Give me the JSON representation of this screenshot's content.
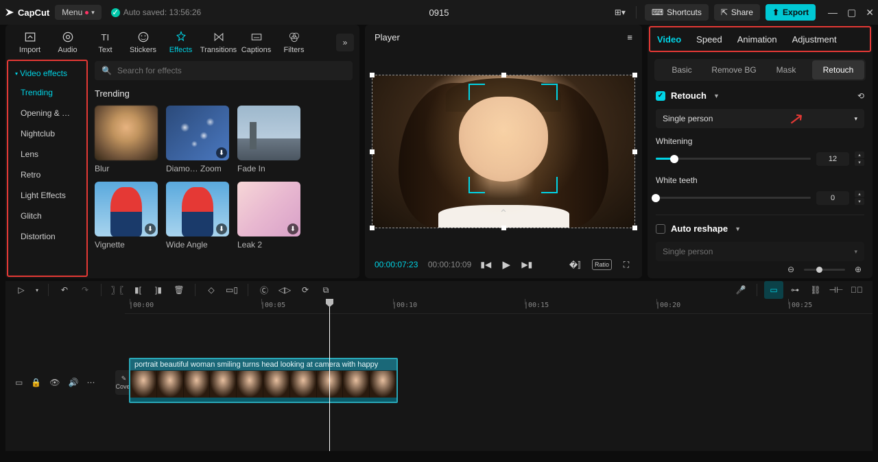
{
  "titlebar": {
    "app": "CapCut",
    "menu": "Menu",
    "autosave": "Auto saved: 13:56:26",
    "project_name": "0915",
    "shortcuts": "Shortcuts",
    "share": "Share",
    "export": "Export"
  },
  "media_tabs": [
    "Import",
    "Audio",
    "Text",
    "Stickers",
    "Effects",
    "Transitions",
    "Captions",
    "Filters"
  ],
  "media_tab_active": 4,
  "effect_sidebar": {
    "title": "Video effects",
    "items": [
      "Trending",
      "Opening & …",
      "Nightclub",
      "Lens",
      "Retro",
      "Light Effects",
      "Glitch",
      "Distortion"
    ],
    "active": 0
  },
  "search_placeholder": "Search for effects",
  "effects_section": "Trending",
  "effects": [
    {
      "label": "Blur",
      "class": "th-blur",
      "dl": false
    },
    {
      "label": "Diamo… Zoom",
      "class": "th-diamond",
      "dl": true
    },
    {
      "label": "Fade In",
      "class": "th-city",
      "dl": false
    },
    {
      "label": "Vignette",
      "class": "th-person",
      "dl": true
    },
    {
      "label": "Wide Angle",
      "class": "th-person",
      "dl": true
    },
    {
      "label": "Leak 2",
      "class": "th-soft",
      "dl": true
    }
  ],
  "player": {
    "title": "Player",
    "current": "00:00:07:23",
    "total": "00:00:10:09",
    "ratio": "Ratio"
  },
  "right": {
    "tabs": [
      "Video",
      "Speed",
      "Animation",
      "Adjustment"
    ],
    "tab_active": 0,
    "subtabs": [
      "Basic",
      "Remove BG",
      "Mask",
      "Retouch"
    ],
    "subtab_active": 3,
    "retouch": {
      "label": "Retouch",
      "mode": "Single person",
      "whitening_label": "Whitening",
      "whitening_val": "12",
      "whiteteeth_label": "White teeth",
      "whiteteeth_val": "0",
      "autoreshape_label": "Auto reshape",
      "autoreshape_mode": "Single person"
    }
  },
  "timeline": {
    "labels": [
      "|00:00",
      "|00:05",
      "|00:10",
      "|00:15",
      "|00:20",
      "|00:25"
    ],
    "clip_title": "portrait beautiful woman smiling turns head looking at camera with happy",
    "cover": "Cover"
  }
}
